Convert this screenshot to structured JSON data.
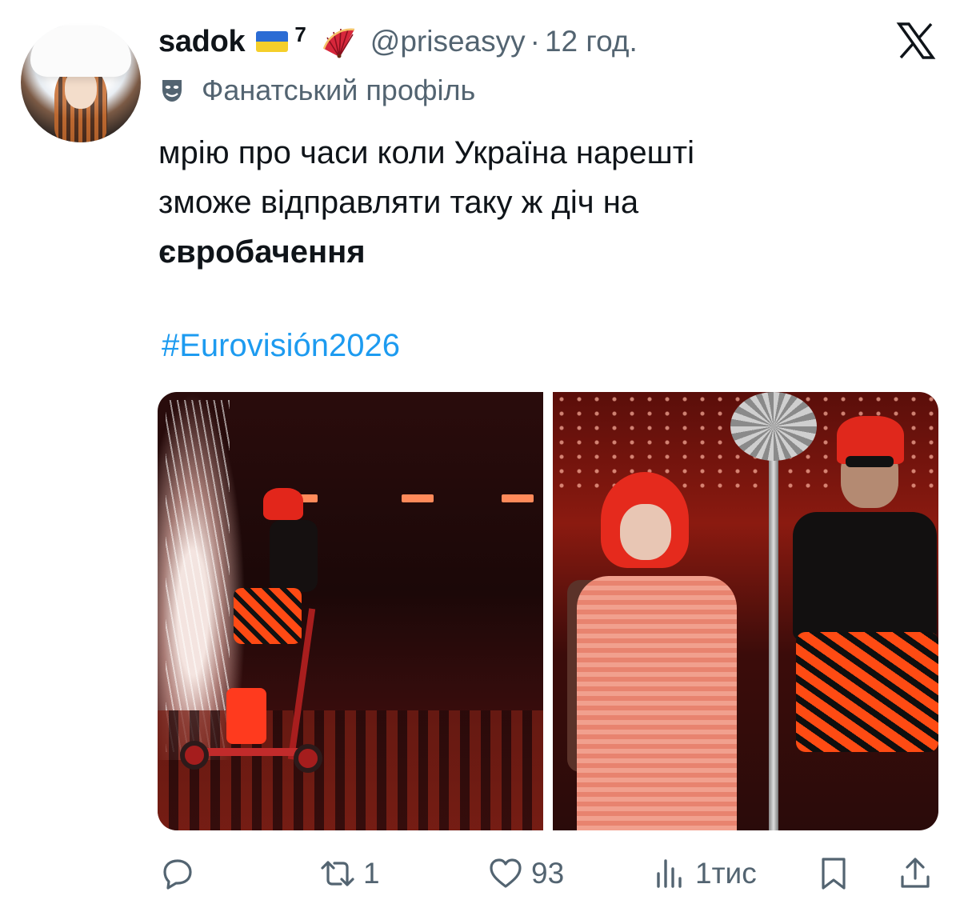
{
  "author": {
    "name": "sadok",
    "flag": "ukraine-flag",
    "superscript": "7",
    "emoji": "folding-fan",
    "handle": "@priseasyy",
    "separator": "·",
    "time": "12 год."
  },
  "badge": {
    "icon": "theater-mask-icon",
    "label": "Фанатський профіль"
  },
  "tweet": {
    "line1": "мрію про часи коли Україна нарешті",
    "line2": "зможе відправляти таку ж діч на",
    "line3_bold": "євробачення",
    "hashtag": "#Eurovisión2026"
  },
  "actions": {
    "reply": {
      "icon": "reply-icon",
      "count": ""
    },
    "retweet": {
      "icon": "retweet-icon",
      "count": "1"
    },
    "like": {
      "icon": "heart-icon",
      "count": "93"
    },
    "views": {
      "icon": "views-icon",
      "count": "1тис"
    },
    "bookmark": {
      "icon": "bookmark-icon"
    },
    "share": {
      "icon": "share-icon"
    }
  },
  "colors": {
    "text": "#0f1419",
    "secondary": "#536471",
    "link": "#1d9bf0",
    "flag_blue": "#2b6cd4",
    "flag_yellow": "#f5cf2a"
  }
}
